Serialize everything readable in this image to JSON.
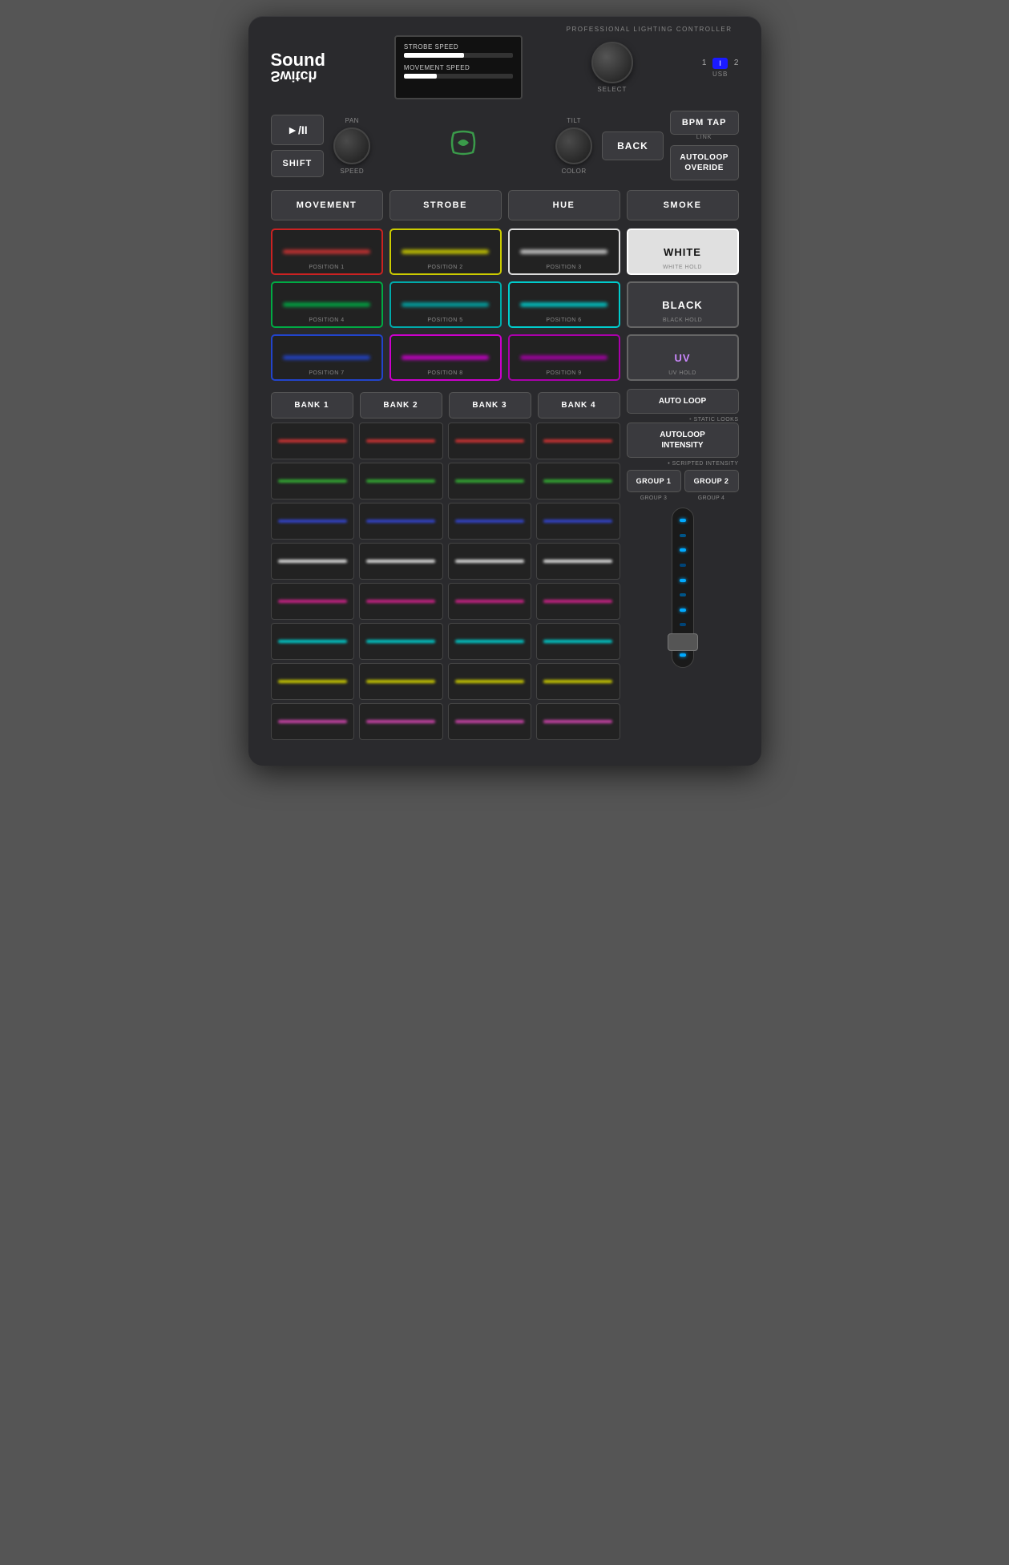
{
  "device": {
    "title": "SoundSwitch",
    "subtitle": "PROFESSIONAL LIGHTING CONTROLLER",
    "logo_main": "Sound",
    "logo_flip": "Switch"
  },
  "display": {
    "strobe_label": "STROBE SPEED",
    "strobe_fill": 55,
    "movement_label": "MOVEMENT SPEED",
    "movement_fill": 30
  },
  "usb": {
    "num1": "1",
    "num2": "2",
    "label": "USB"
  },
  "select": {
    "label": "SELECT"
  },
  "controls": {
    "play_pause": "►/II",
    "shift": "SHIFT",
    "pan_label": "PAN",
    "speed_label": "SPEED",
    "tilt_label": "TILT",
    "color_label": "COLOR",
    "back": "BACK",
    "bpm_tap": "BPM TAP",
    "link": "LINK",
    "autoloop_override": "AUTOLOOP\nOVERIDE"
  },
  "functions": {
    "movement": "MOVEMENT",
    "strobe": "STROBE",
    "hue": "HUE",
    "smoke": "SMOKE"
  },
  "positions": {
    "pos1": "POSITION 1",
    "pos2": "POSITION 2",
    "pos3": "POSITION 3",
    "pos4": "POSITION 4",
    "pos5": "POSITION 5",
    "pos6": "POSITION 6",
    "pos7": "POSITION 7",
    "pos8": "POSITION 8",
    "pos9": "POSITION 9"
  },
  "special_pads": {
    "white": "WHITE",
    "white_hold": "WHITE HOLD",
    "black": "BLACK",
    "black_hold": "BLACK HOLD",
    "uv": "UV",
    "uv_hold": "UV HOLD"
  },
  "banks": {
    "bank1": "BANK 1",
    "bank2": "BANK 2",
    "bank3": "BANK 3",
    "bank4": "BANK 4"
  },
  "auto": {
    "auto_loop": "AUTO\nLOOP",
    "static_looks": "STATIC LOOKS",
    "autoloop_intensity": "AUTOLOOP\nINTENSITY",
    "scripted_intensity": "SCRIPTED INTENSITY",
    "group1": "GROUP 1",
    "group2": "GROUP 2",
    "group3": "GROUP 3",
    "group4": "GROUP 4"
  },
  "pad_rows": {
    "row1_colors": [
      "#cc3333",
      "#cc3333",
      "#cc3333",
      "#cc3333"
    ],
    "row2_colors": [
      "#33aa33",
      "#33aa33",
      "#33aa33",
      "#33aa33"
    ],
    "row3_colors": [
      "#3344cc",
      "#3344cc",
      "#3344cc",
      "#3344cc"
    ],
    "row4_colors": [
      "#dddddd",
      "#dddddd",
      "#dddddd",
      "#dddddd"
    ],
    "row5_colors": [
      "#cc2288",
      "#cc2288",
      "#cc2288",
      "#cc2288"
    ],
    "row6_colors": [
      "#00cccc",
      "#00cccc",
      "#00cccc",
      "#00cccc"
    ],
    "row7_colors": [
      "#cccc00",
      "#cccc00",
      "#cccc00",
      "#cccc00"
    ],
    "row8_colors": [
      "#cc44aa",
      "#cc44aa",
      "#cc44aa",
      "#cc44aa"
    ]
  }
}
